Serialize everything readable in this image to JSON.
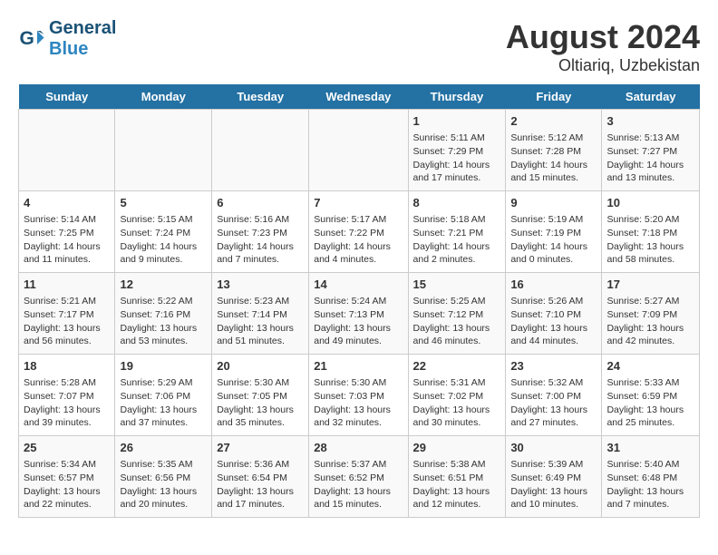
{
  "header": {
    "logo_line1": "General",
    "logo_line2": "Blue",
    "main_title": "August 2024",
    "subtitle": "Oltiariq, Uzbekistan"
  },
  "days_of_week": [
    "Sunday",
    "Monday",
    "Tuesday",
    "Wednesday",
    "Thursday",
    "Friday",
    "Saturday"
  ],
  "weeks": [
    [
      {
        "day": "",
        "content": ""
      },
      {
        "day": "",
        "content": ""
      },
      {
        "day": "",
        "content": ""
      },
      {
        "day": "",
        "content": ""
      },
      {
        "day": "1",
        "content": "Sunrise: 5:11 AM\nSunset: 7:29 PM\nDaylight: 14 hours and 17 minutes."
      },
      {
        "day": "2",
        "content": "Sunrise: 5:12 AM\nSunset: 7:28 PM\nDaylight: 14 hours and 15 minutes."
      },
      {
        "day": "3",
        "content": "Sunrise: 5:13 AM\nSunset: 7:27 PM\nDaylight: 14 hours and 13 minutes."
      }
    ],
    [
      {
        "day": "4",
        "content": "Sunrise: 5:14 AM\nSunset: 7:25 PM\nDaylight: 14 hours and 11 minutes."
      },
      {
        "day": "5",
        "content": "Sunrise: 5:15 AM\nSunset: 7:24 PM\nDaylight: 14 hours and 9 minutes."
      },
      {
        "day": "6",
        "content": "Sunrise: 5:16 AM\nSunset: 7:23 PM\nDaylight: 14 hours and 7 minutes."
      },
      {
        "day": "7",
        "content": "Sunrise: 5:17 AM\nSunset: 7:22 PM\nDaylight: 14 hours and 4 minutes."
      },
      {
        "day": "8",
        "content": "Sunrise: 5:18 AM\nSunset: 7:21 PM\nDaylight: 14 hours and 2 minutes."
      },
      {
        "day": "9",
        "content": "Sunrise: 5:19 AM\nSunset: 7:19 PM\nDaylight: 14 hours and 0 minutes."
      },
      {
        "day": "10",
        "content": "Sunrise: 5:20 AM\nSunset: 7:18 PM\nDaylight: 13 hours and 58 minutes."
      }
    ],
    [
      {
        "day": "11",
        "content": "Sunrise: 5:21 AM\nSunset: 7:17 PM\nDaylight: 13 hours and 56 minutes."
      },
      {
        "day": "12",
        "content": "Sunrise: 5:22 AM\nSunset: 7:16 PM\nDaylight: 13 hours and 53 minutes."
      },
      {
        "day": "13",
        "content": "Sunrise: 5:23 AM\nSunset: 7:14 PM\nDaylight: 13 hours and 51 minutes."
      },
      {
        "day": "14",
        "content": "Sunrise: 5:24 AM\nSunset: 7:13 PM\nDaylight: 13 hours and 49 minutes."
      },
      {
        "day": "15",
        "content": "Sunrise: 5:25 AM\nSunset: 7:12 PM\nDaylight: 13 hours and 46 minutes."
      },
      {
        "day": "16",
        "content": "Sunrise: 5:26 AM\nSunset: 7:10 PM\nDaylight: 13 hours and 44 minutes."
      },
      {
        "day": "17",
        "content": "Sunrise: 5:27 AM\nSunset: 7:09 PM\nDaylight: 13 hours and 42 minutes."
      }
    ],
    [
      {
        "day": "18",
        "content": "Sunrise: 5:28 AM\nSunset: 7:07 PM\nDaylight: 13 hours and 39 minutes."
      },
      {
        "day": "19",
        "content": "Sunrise: 5:29 AM\nSunset: 7:06 PM\nDaylight: 13 hours and 37 minutes."
      },
      {
        "day": "20",
        "content": "Sunrise: 5:30 AM\nSunset: 7:05 PM\nDaylight: 13 hours and 35 minutes."
      },
      {
        "day": "21",
        "content": "Sunrise: 5:30 AM\nSunset: 7:03 PM\nDaylight: 13 hours and 32 minutes."
      },
      {
        "day": "22",
        "content": "Sunrise: 5:31 AM\nSunset: 7:02 PM\nDaylight: 13 hours and 30 minutes."
      },
      {
        "day": "23",
        "content": "Sunrise: 5:32 AM\nSunset: 7:00 PM\nDaylight: 13 hours and 27 minutes."
      },
      {
        "day": "24",
        "content": "Sunrise: 5:33 AM\nSunset: 6:59 PM\nDaylight: 13 hours and 25 minutes."
      }
    ],
    [
      {
        "day": "25",
        "content": "Sunrise: 5:34 AM\nSunset: 6:57 PM\nDaylight: 13 hours and 22 minutes."
      },
      {
        "day": "26",
        "content": "Sunrise: 5:35 AM\nSunset: 6:56 PM\nDaylight: 13 hours and 20 minutes."
      },
      {
        "day": "27",
        "content": "Sunrise: 5:36 AM\nSunset: 6:54 PM\nDaylight: 13 hours and 17 minutes."
      },
      {
        "day": "28",
        "content": "Sunrise: 5:37 AM\nSunset: 6:52 PM\nDaylight: 13 hours and 15 minutes."
      },
      {
        "day": "29",
        "content": "Sunrise: 5:38 AM\nSunset: 6:51 PM\nDaylight: 13 hours and 12 minutes."
      },
      {
        "day": "30",
        "content": "Sunrise: 5:39 AM\nSunset: 6:49 PM\nDaylight: 13 hours and 10 minutes."
      },
      {
        "day": "31",
        "content": "Sunrise: 5:40 AM\nSunset: 6:48 PM\nDaylight: 13 hours and 7 minutes."
      }
    ]
  ]
}
